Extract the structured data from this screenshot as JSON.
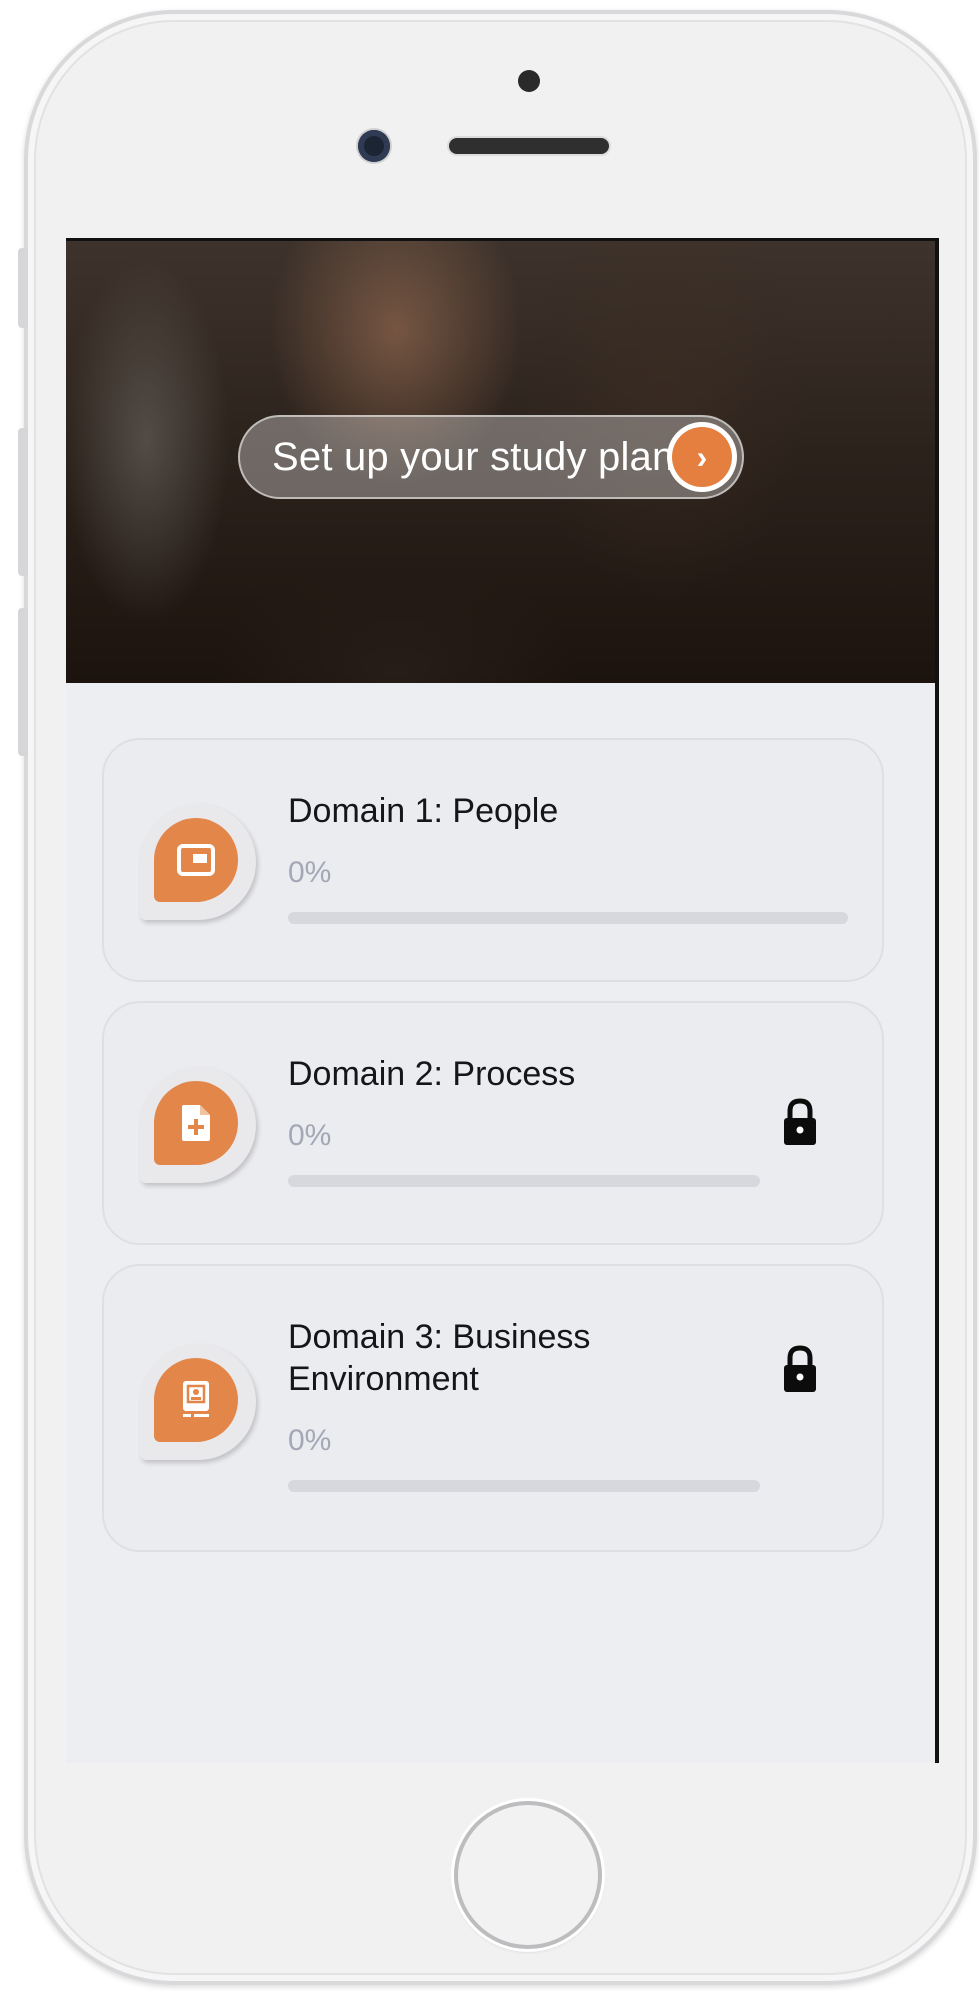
{
  "hero": {
    "cta_label": "Set up your study plan",
    "arrow_glyph": "›"
  },
  "domains": [
    {
      "title": "Domain 1: People",
      "progress_label": "0%",
      "progress": 0,
      "icon": "presentation-icon",
      "locked": false
    },
    {
      "title": "Domain 2: Process",
      "progress_label": "0%",
      "progress": 0,
      "icon": "document-add-icon",
      "locked": true
    },
    {
      "title_line1": "Domain 3: Business",
      "title_line2": "Environment",
      "progress_label": "0%",
      "progress": 0,
      "icon": "id-card-icon",
      "locked": true
    }
  ],
  "colors": {
    "accent": "#e3864a",
    "screen_background": "#edeef1",
    "muted_text": "#a4a8b6"
  }
}
